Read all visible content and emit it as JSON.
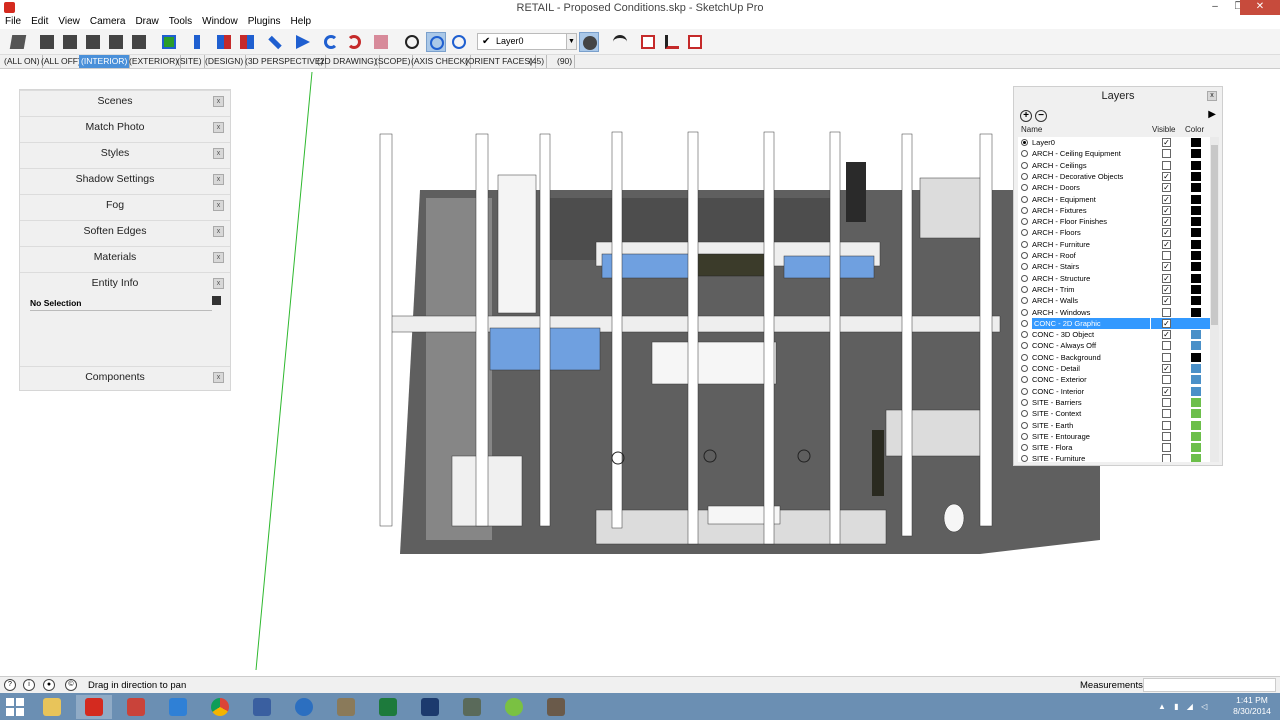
{
  "window": {
    "title": "RETAIL - Proposed Conditions.skp - SketchUp Pro",
    "minimize": "–",
    "restore": "❐",
    "close": "✕"
  },
  "menu": [
    "File",
    "Edit",
    "View",
    "Camera",
    "Draw",
    "Tools",
    "Window",
    "Plugins",
    "Help"
  ],
  "toolbar": {
    "current_layer": "Layer0",
    "current_layer_check": "✔"
  },
  "scenes": [
    "(ALL ON)",
    "(ALL OFF)",
    "(INTERIOR)",
    "(EXTERIOR)",
    "(SITE)",
    "(DESIGN)",
    "(3D PERSPECTIVE)",
    "(2D DRAWING)",
    "(SCOPE)",
    "(AXIS CHECK)",
    "(ORIENT FACES)",
    "(45)",
    "(90)"
  ],
  "active_scene_index": 2,
  "trays": {
    "items": [
      "Scenes",
      "Match Photo",
      "Styles",
      "Shadow Settings",
      "Fog",
      "Soften Edges",
      "Materials",
      "Entity Info"
    ],
    "components": "Components",
    "close_glyph": "x",
    "entity_info": "No Selection"
  },
  "layers_panel": {
    "title": "Layers",
    "close_glyph": "x",
    "add_glyph": "+",
    "remove_glyph": "−",
    "details_glyph": "▶",
    "col_name": "Name",
    "col_visible": "Visible",
    "col_color": "Color",
    "check_glyph": "✓",
    "rows": [
      {
        "name": "Layer0",
        "visible": true,
        "color": "#000000",
        "active": true
      },
      {
        "name": "ARCH - Ceiling Equipment",
        "visible": false,
        "color": "#000000"
      },
      {
        "name": "ARCH - Ceilings",
        "visible": false,
        "color": "#000000"
      },
      {
        "name": "ARCH - Decorative Objects",
        "visible": true,
        "color": "#000000"
      },
      {
        "name": "ARCH - Doors",
        "visible": true,
        "color": "#000000"
      },
      {
        "name": "ARCH - Equipment",
        "visible": true,
        "color": "#000000"
      },
      {
        "name": "ARCH - Fixtures",
        "visible": true,
        "color": "#000000"
      },
      {
        "name": "ARCH - Floor Finishes",
        "visible": true,
        "color": "#000000"
      },
      {
        "name": "ARCH - Floors",
        "visible": true,
        "color": "#000000"
      },
      {
        "name": "ARCH - Furniture",
        "visible": true,
        "color": "#000000"
      },
      {
        "name": "ARCH - Roof",
        "visible": false,
        "color": "#000000"
      },
      {
        "name": "ARCH - Stairs",
        "visible": true,
        "color": "#000000"
      },
      {
        "name": "ARCH - Structure",
        "visible": true,
        "color": "#000000"
      },
      {
        "name": "ARCH - Trim",
        "visible": true,
        "color": "#000000"
      },
      {
        "name": "ARCH - Walls",
        "visible": true,
        "color": "#000000"
      },
      {
        "name": "ARCH - Windows",
        "visible": false,
        "color": "#000000"
      },
      {
        "name": "CONC - 2D Graphic",
        "visible": true,
        "color": "#3399ff",
        "selected": true
      },
      {
        "name": "CONC - 3D Object",
        "visible": true,
        "color": "#4a90c8"
      },
      {
        "name": "CONC - Always Off",
        "visible": false,
        "color": "#4a90c8"
      },
      {
        "name": "CONC - Background",
        "visible": false,
        "color": "#000000"
      },
      {
        "name": "CONC - Detail",
        "visible": true,
        "color": "#4a90c8"
      },
      {
        "name": "CONC - Exterior",
        "visible": false,
        "color": "#4a90c8"
      },
      {
        "name": "CONC - Interior",
        "visible": true,
        "color": "#4a90c8"
      },
      {
        "name": "SITE - Barriers",
        "visible": false,
        "color": "#6cbf4a"
      },
      {
        "name": "SITE - Context",
        "visible": false,
        "color": "#6cbf4a"
      },
      {
        "name": "SITE - Earth",
        "visible": false,
        "color": "#6cbf4a"
      },
      {
        "name": "SITE - Entourage",
        "visible": false,
        "color": "#6cbf4a"
      },
      {
        "name": "SITE - Flora",
        "visible": false,
        "color": "#6cbf4a"
      },
      {
        "name": "SITE - Furniture",
        "visible": false,
        "color": "#6cbf4a"
      }
    ]
  },
  "status": {
    "hint": "Drag in direction to pan",
    "icons": [
      "?",
      "i",
      "●",
      "©"
    ],
    "measurements_label": "Measurements",
    "measurements_value": ""
  },
  "clock": {
    "time": "1:41 PM",
    "date": "8/30/2014"
  },
  "colors": {
    "accent": "#4a90d9",
    "taskbar": "#6b8fb3",
    "selection": "#3399ff"
  }
}
